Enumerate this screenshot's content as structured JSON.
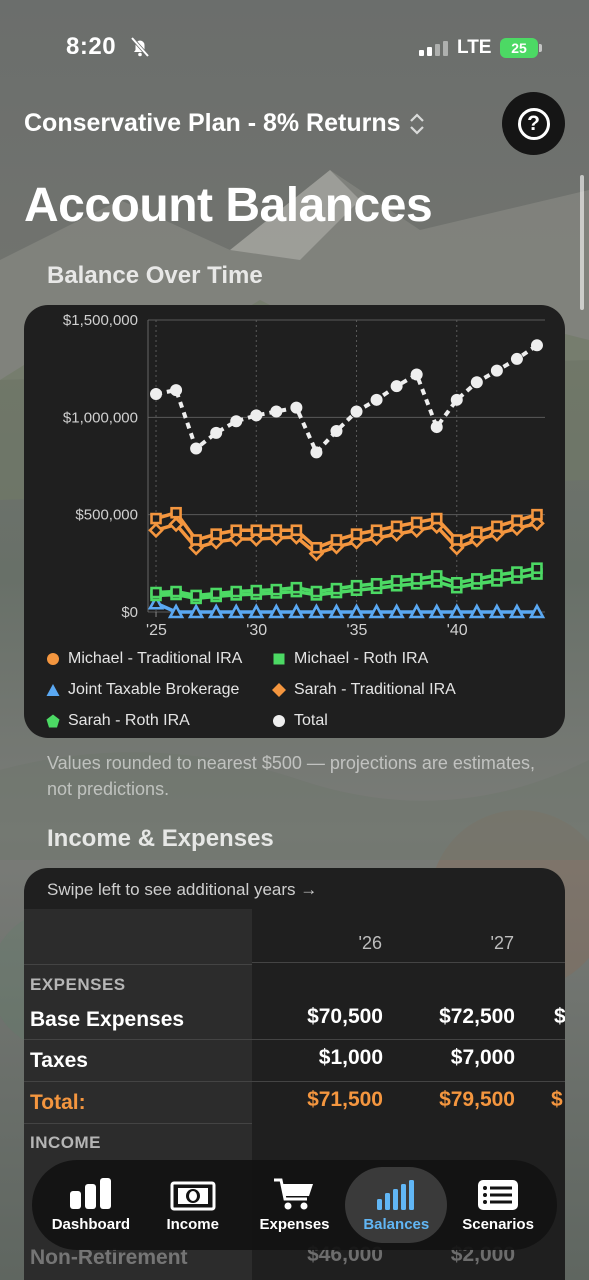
{
  "status_bar": {
    "time": "8:20",
    "network": "LTE",
    "battery": "25"
  },
  "header": {
    "plan_label": "Conservative Plan - 8% Returns",
    "help_label": "?",
    "title": "Account Balances"
  },
  "balance_section": {
    "title": "Balance Over Time"
  },
  "chart_data": {
    "type": "line",
    "title": "",
    "xlabel": "",
    "ylabel": "",
    "x": [
      2025,
      2026,
      2027,
      2028,
      2029,
      2030,
      2031,
      2032,
      2033,
      2034,
      2035,
      2036,
      2037,
      2038,
      2039,
      2040,
      2041,
      2042,
      2043,
      2044
    ],
    "x_tick_labels": [
      "'25",
      "'30",
      "'35",
      "'40"
    ],
    "x_tick_values": [
      2025,
      2030,
      2035,
      2040
    ],
    "y_tick_labels": [
      "$1,500,000",
      "$1,000,000",
      "$500,000",
      "$0"
    ],
    "y_tick_values": [
      1500000,
      1000000,
      500000,
      0
    ],
    "ylim": [
      0,
      1500000
    ],
    "grid": true,
    "legend_position": "bottom",
    "series": [
      {
        "name": "Michael - Traditional IRA",
        "color": "#f4963f",
        "marker": "circle",
        "legend_marker": "circle",
        "line_marker": "square",
        "values": [
          480000,
          510000,
          370000,
          400000,
          420000,
          420000,
          420000,
          420000,
          330000,
          370000,
          400000,
          420000,
          440000,
          460000,
          480000,
          370000,
          410000,
          440000,
          470000,
          500000
        ]
      },
      {
        "name": "Sarah - Traditional IRA",
        "color": "#f4963f",
        "marker": "diamond",
        "legend_marker": "diamond",
        "line_marker": "diamond",
        "values": [
          420000,
          450000,
          330000,
          360000,
          375000,
          375000,
          380000,
          385000,
          300000,
          335000,
          360000,
          380000,
          400000,
          420000,
          440000,
          330000,
          370000,
          400000,
          430000,
          455000
        ]
      },
      {
        "name": "Michael - Roth IRA",
        "color": "#4cd964",
        "marker": "square",
        "legend_marker": "square",
        "line_marker": "square",
        "values": [
          100000,
          105000,
          85000,
          95000,
          105000,
          110000,
          115000,
          125000,
          105000,
          120000,
          135000,
          145000,
          160000,
          170000,
          185000,
          150000,
          170000,
          190000,
          205000,
          225000
        ]
      },
      {
        "name": "Sarah - Roth IRA",
        "color": "#4cd964",
        "marker": "pentagon",
        "legend_marker": "pentagon",
        "line_marker": "square",
        "values": [
          85000,
          90000,
          70000,
          80000,
          88000,
          92000,
          98000,
          105000,
          88000,
          100000,
          112000,
          122000,
          135000,
          145000,
          155000,
          125000,
          145000,
          160000,
          175000,
          195000
        ]
      },
      {
        "name": "Joint Taxable Brokerage",
        "color": "#5aa8f2",
        "marker": "triangle",
        "legend_marker": "triangle",
        "line_marker": "triangle",
        "values": [
          45000,
          0,
          0,
          0,
          0,
          0,
          0,
          0,
          0,
          0,
          0,
          0,
          0,
          0,
          0,
          0,
          0,
          0,
          0,
          0
        ]
      },
      {
        "name": "Total",
        "color": "#eeeeee",
        "marker": "circle",
        "legend_marker": "circle",
        "line_marker": "circle",
        "dashed": true,
        "values": [
          1120000,
          1140000,
          840000,
          920000,
          980000,
          1010000,
          1030000,
          1050000,
          820000,
          930000,
          1030000,
          1090000,
          1160000,
          1220000,
          950000,
          1090000,
          1180000,
          1240000,
          1300000,
          1370000
        ]
      }
    ]
  },
  "legend_rows": [
    [
      {
        "label": "Michael - Traditional IRA",
        "color": "#f4963f",
        "marker": "circle"
      },
      {
        "label": "Michael - Roth IRA",
        "color": "#4cd964",
        "marker": "square"
      }
    ],
    [
      {
        "label": "Joint Taxable Brokerage",
        "color": "#5aa8f2",
        "marker": "triangle"
      },
      {
        "label": "Sarah - Traditional IRA",
        "color": "#f4963f",
        "marker": "diamond"
      }
    ],
    [
      {
        "label": "Sarah - Roth IRA",
        "color": "#4cd964",
        "marker": "pentagon"
      },
      {
        "label": "Total",
        "color": "#eeeeee",
        "marker": "circle"
      }
    ]
  ],
  "balance_note": "Values rounded to nearest $500 — projections are estimates, not predictions.",
  "income_section": {
    "title": "Income & Expenses",
    "swipe_hint": "Swipe left to see additional years →",
    "years": [
      "'26",
      "'27"
    ],
    "expenses_header": "EXPENSES",
    "income_header": "INCOME",
    "rows": [
      {
        "label": "Base Expenses",
        "values": [
          "$70,500",
          "$72,500",
          "$"
        ]
      },
      {
        "label": "Taxes",
        "values": [
          "$1,000",
          "$7,000",
          ""
        ]
      },
      {
        "label": "Total:",
        "values": [
          "$71,500",
          "$79,500",
          "$"
        ]
      }
    ],
    "hidden_row_label": "Non-Retirement",
    "hidden_row_values": [
      "$46,000",
      "$2,000"
    ]
  },
  "tabbar": {
    "tabs": [
      {
        "label": "Dashboard",
        "icon": "dashboard-icon",
        "active": false
      },
      {
        "label": "Income",
        "icon": "income-icon",
        "active": false
      },
      {
        "label": "Expenses",
        "icon": "cart-icon",
        "active": false
      },
      {
        "label": "Balances",
        "icon": "balances-icon",
        "active": true
      },
      {
        "label": "Scenarios",
        "icon": "scenarios-icon",
        "active": false
      }
    ]
  }
}
